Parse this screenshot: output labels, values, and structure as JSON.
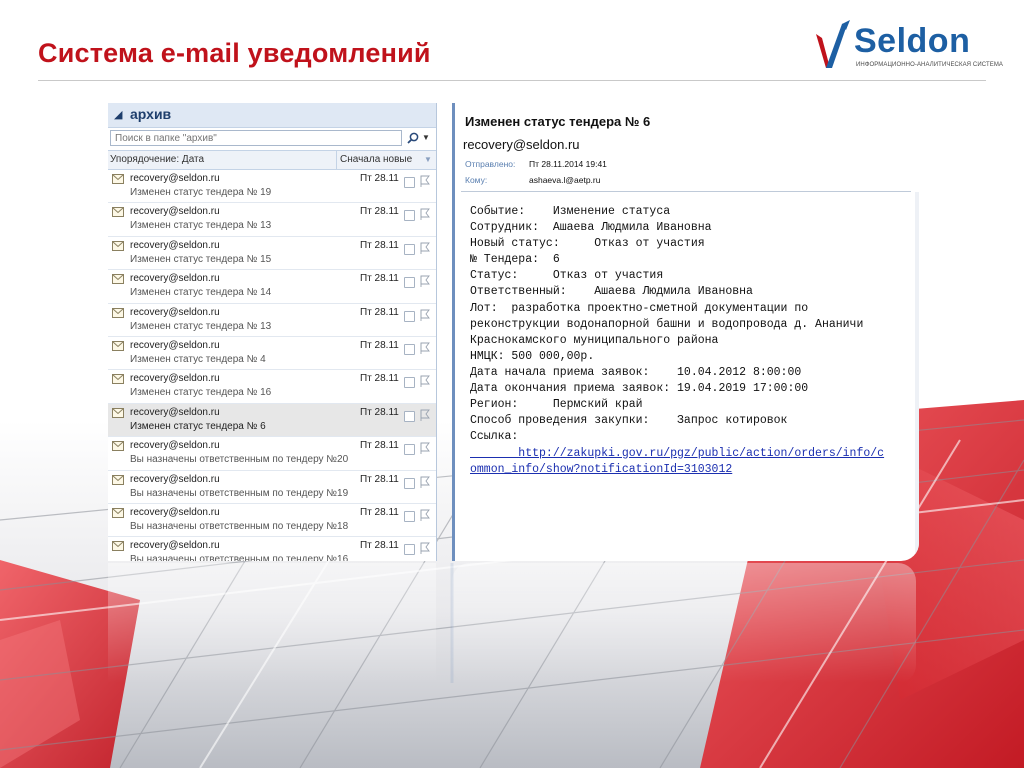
{
  "slide": {
    "title": "Система e-mail уведомлений",
    "logo_word": "Seldon",
    "logo_tagline": "ИНФОРМАЦИОННО-АНАЛИТИЧЕСКАЯ СИСТЕМА",
    "colors": {
      "title": "#c0121b",
      "logo": "#1d5fa3",
      "accent_red": "#e3343b",
      "reading_border": "#6e8fbe"
    }
  },
  "mail_list": {
    "folder": "архив",
    "search_placeholder": "Поиск в папке \"архив\"",
    "sort_by": "Упорядочение: Дата",
    "sort_order": "Сначала новые",
    "messages": [
      {
        "from": "recovery@seldon.ru",
        "date": "Пт 28.11",
        "subject": "Изменен статус тендера № 19",
        "selected": false
      },
      {
        "from": "recovery@seldon.ru",
        "date": "Пт 28.11",
        "subject": "Изменен статус тендера № 13",
        "selected": false
      },
      {
        "from": "recovery@seldon.ru",
        "date": "Пт 28.11",
        "subject": "Изменен статус тендера № 15",
        "selected": false
      },
      {
        "from": "recovery@seldon.ru",
        "date": "Пт 28.11",
        "subject": "Изменен статус тендера № 14",
        "selected": false
      },
      {
        "from": "recovery@seldon.ru",
        "date": "Пт 28.11",
        "subject": "Изменен статус тендера № 13",
        "selected": false
      },
      {
        "from": "recovery@seldon.ru",
        "date": "Пт 28.11",
        "subject": "Изменен статус тендера № 4",
        "selected": false
      },
      {
        "from": "recovery@seldon.ru",
        "date": "Пт 28.11",
        "subject": "Изменен статус тендера № 16",
        "selected": false
      },
      {
        "from": "recovery@seldon.ru",
        "date": "Пт 28.11",
        "subject": "Изменен статус тендера № 6",
        "selected": true
      },
      {
        "from": "recovery@seldon.ru",
        "date": "Пт 28.11",
        "subject": "Вы назначены ответственным по тендеру №20",
        "selected": false
      },
      {
        "from": "recovery@seldon.ru",
        "date": "Пт 28.11",
        "subject": "Вы назначены ответственным по тендеру №19",
        "selected": false
      },
      {
        "from": "recovery@seldon.ru",
        "date": "Пт 28.11",
        "subject": "Вы назначены ответственным по тендеру №18",
        "selected": false
      },
      {
        "from": "recovery@seldon.ru",
        "date": "Пт 28.11",
        "subject": "Вы назначены ответственным по тендеру №16",
        "selected": false
      }
    ]
  },
  "reading_pane": {
    "subject": "Изменен статус тендера № 6",
    "from": "recovery@seldon.ru",
    "sent_label": "Отправлено:",
    "sent_value": "Пт 28.11.2014 19:41",
    "to_label": "Кому:",
    "to_value": "ashaeva.l@aetp.ru",
    "body_lines": [
      "Событие:    Изменение статуса",
      "Сотрудник:  Ашаева Людмила Ивановна",
      "Новый статус:     Отказ от участия",
      "№ Тендера:  6",
      "Статус:     Отказ от участия",
      "Ответственный:    Ашаева Людмила Ивановна",
      "Лот:  разработка проектно-сметной документации по",
      "реконструкции водонапорной башни и водопровода д. Ананичи",
      "Краснокамского муниципального района",
      "НМЦК: 500 000,00р.",
      "Дата начала приема заявок:    10.04.2012 8:00:00",
      "Дата окончания приема заявок: 19.04.2019 17:00:00",
      "Регион:     Пермский край",
      "Способ проведения закупки:    Запрос котировок",
      "Ссылка:"
    ],
    "link_line1": "       http://zakupki.gov.ru/pgz/public/action/orders/info/c",
    "link_line2": "ommon_info/show?notificationId=3103012"
  }
}
